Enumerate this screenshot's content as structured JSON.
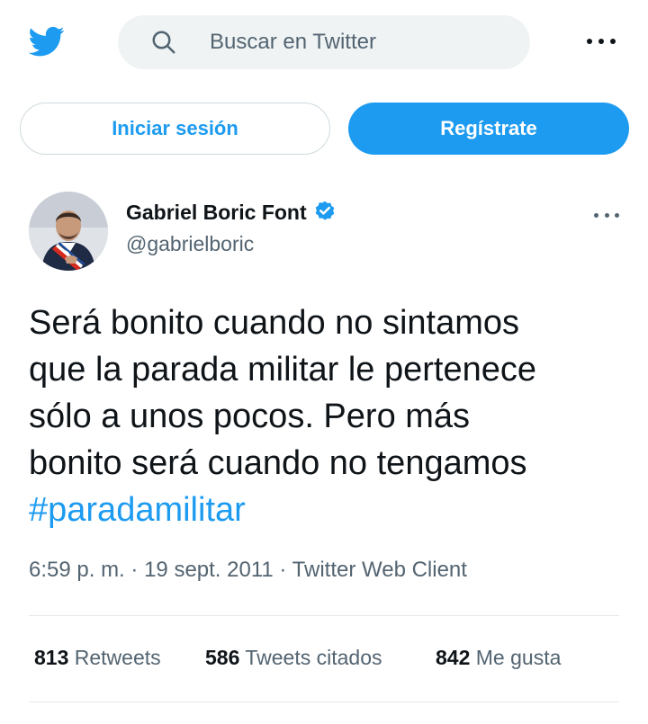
{
  "header": {
    "logo_icon": "twitter-bird-icon",
    "search_placeholder": "Buscar en Twitter",
    "more_icon": "more-horizontal-icon"
  },
  "auth": {
    "login_label": "Iniciar sesión",
    "signup_label": "Regístrate"
  },
  "tweet": {
    "author_name": "Gabriel Boric Font",
    "author_handle": "@gabrielboric",
    "verified": true,
    "text_lines": [
      "Será bonito cuando no sintamos",
      "que la parada militar le pertenece",
      "sólo a unos pocos. Pero más",
      "bonito será cuando no tengamos"
    ],
    "hashtag": "#paradamilitar",
    "time": "6:59 p. m.",
    "date": "19 sept. 2011",
    "source": "Twitter Web Client",
    "separator": "·"
  },
  "stats": {
    "retweets_count": "813",
    "retweets_label": "Retweets",
    "quotes_count": "586",
    "quotes_label": "Tweets citados",
    "likes_count": "842",
    "likes_label": "Me gusta"
  },
  "colors": {
    "accent": "#1d9bf0",
    "secondary_text": "#536471",
    "primary_text": "#0f1419",
    "search_bg": "#eff3f4"
  }
}
